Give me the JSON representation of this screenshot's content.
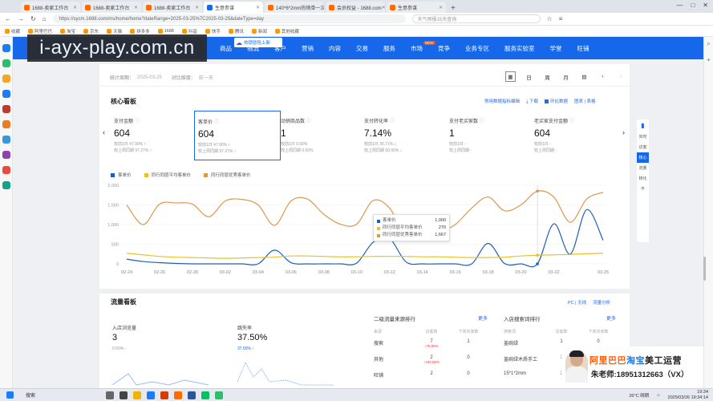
{
  "browser": {
    "tabs": [
      {
        "label": "1688-卖家工作台",
        "active": false
      },
      {
        "label": "1688-卖家工作台",
        "active": false
      },
      {
        "label": "1688-卖家工作台",
        "active": false
      },
      {
        "label": "生意参谋",
        "active": true
      },
      {
        "label": "140*6*2mm热销单一次性水",
        "active": false
      },
      {
        "label": "会员权益 - 1688.com",
        "active": false
      },
      {
        "label": "生意参谋",
        "active": false
      }
    ],
    "url": "https://sycm.1688.com/ms/home/home?dateRange=2025-03-25%7C2025-03-25&dateType=day",
    "search_placeholder": "天气预报15天查询",
    "bookmarks": [
      "收藏",
      "阿里巴巴",
      "淘宝",
      "京东",
      "天猫",
      "拼多多",
      "1688",
      "抖音",
      "快手",
      "腾讯",
      "新闻",
      "其他收藏"
    ],
    "window_controls": [
      "—",
      "□",
      "✕"
    ]
  },
  "watermark": "i-ayx-play.com.cn",
  "promo_badge": "热销冒险上新",
  "topnav": {
    "items": [
      "商品",
      "物流",
      "客户",
      "营销",
      "内容",
      "交易",
      "服务",
      "市场",
      "竞争",
      "业务专区",
      "服务实验室",
      "学堂",
      "旺铺"
    ],
    "new_badge": "NEW"
  },
  "statbar": {
    "period_label": "统计周期：",
    "period_value": "2025-03-25",
    "compare_label": "对比维度：",
    "compare_value": "前一天",
    "date_controls": [
      "日",
      "周",
      "月"
    ]
  },
  "core": {
    "title": "核心看板",
    "tools": [
      "常用数据指标编辑",
      "下载",
      "环比数据",
      "图表 | 表格"
    ],
    "metrics": [
      {
        "label": "支付金额",
        "value": "604",
        "sub1": "较前1日 47.90%",
        "sub2": "较上周同期 97.27%",
        "dir": "up",
        "selected": false
      },
      {
        "label": "客单价",
        "value": "604",
        "sub1": "较前1日 47.90%",
        "sub2": "较上周同期 97.27%",
        "dir": "up",
        "selected": true
      },
      {
        "label": "动销商品数",
        "value": "1",
        "sub1": "较前1日 0.00%",
        "sub2": "较上周同期 0.00%",
        "dir": "none",
        "selected": false
      },
      {
        "label": "支付转化率",
        "value": "7.14%",
        "sub1": "较前1日 35.71%",
        "sub2": "较上周同期 50.00%",
        "dir": "down",
        "selected": false
      },
      {
        "label": "支付老买家数",
        "value": "1",
        "sub1": "较前1日 -",
        "sub2": "较上周同期 -",
        "dir": "none",
        "selected": false
      },
      {
        "label": "老买家支付金额",
        "value": "604",
        "sub1": "较前1日 -",
        "sub2": "较上周同期 -",
        "dir": "none",
        "selected": false
      }
    ]
  },
  "chart_data": {
    "type": "line",
    "categories": [
      "02-24",
      "02-25",
      "02-26",
      "02-27",
      "02-28",
      "03-01",
      "03-02",
      "03-03",
      "03-04",
      "03-05",
      "03-06",
      "03-07",
      "03-08",
      "03-09",
      "03-10",
      "03-11",
      "03-12",
      "03-13",
      "03-14",
      "03-15",
      "03-16",
      "03-17",
      "03-18",
      "03-19",
      "03-20",
      "03-21",
      "03-22",
      "03-23",
      "03-24",
      "03-25"
    ],
    "tick_labels": [
      "02-24",
      "02-26",
      "02-28",
      "03-02",
      "03-04",
      "03-06",
      "03-08",
      "03-10",
      "03-12",
      "03-14",
      "03-16",
      "03-18",
      "03-20",
      "03-22",
      "03-25"
    ],
    "ylim": [
      0,
      2000
    ],
    "yticks": [
      "0",
      "500",
      "1,000",
      "1,500",
      "2,000"
    ],
    "series": [
      {
        "name": "客单价",
        "color": "#1d5fb8",
        "values": [
          120,
          60,
          30,
          10,
          0,
          0,
          0,
          0,
          0,
          350,
          30,
          0,
          0,
          0,
          20,
          550,
          640,
          50,
          0,
          0,
          0,
          0,
          520,
          10,
          0,
          0,
          1020,
          250,
          1380,
          600
        ]
      },
      {
        "name": "同行同层平均客单价",
        "color": "#e6c32a",
        "values": [
          270,
          230,
          190,
          170,
          160,
          150,
          140,
          150,
          160,
          170,
          200,
          200,
          190,
          180,
          180,
          190,
          190,
          190,
          180,
          180,
          170,
          160,
          160,
          170,
          200,
          220,
          230,
          240,
          260,
          270
        ]
      },
      {
        "name": "同行同层优秀客单价",
        "color": "#d9994a",
        "values": [
          1500,
          1000,
          1520,
          1550,
          1520,
          1200,
          1600,
          1640,
          1500,
          980,
          1600,
          1650,
          1260,
          1010,
          1010,
          1610,
          1420,
          720,
          820,
          820,
          1000,
          1420,
          1700,
          1350,
          1500,
          1850,
          1700,
          1060,
          1650,
          1820
        ]
      }
    ],
    "tooltip": {
      "rows": [
        {
          "name": "客单价",
          "value": "1,000"
        },
        {
          "name": "同行同层平均客单价",
          "value": "270"
        },
        {
          "name": "同行同层优秀客单价",
          "value": "1,667"
        }
      ]
    },
    "legend_position": "top-left",
    "grid": true
  },
  "flow": {
    "title": "流量看板",
    "tools": [
      "PC | 无线",
      "流量分析"
    ],
    "uv_label": "入店浏览量",
    "uv_value": "3",
    "uv_sub": "0.00% -",
    "conv_label": "跳失率",
    "conv_value": "37.50%",
    "conv_sub": "37.50% ↑",
    "rank1": {
      "title": "二级流量来源排行",
      "more": "更多",
      "cols": [
        "来源",
        "访客数",
        "下单买家数"
      ],
      "rows": [
        {
          "name": "搜索",
          "visitors": "7",
          "sub": "↑75.00%",
          "buyers": "1"
        },
        {
          "name": "其他",
          "visitors": "2",
          "sub": "↑100.00%",
          "buyers": "0"
        },
        {
          "name": "旺铺",
          "visitors": "2",
          "sub": "",
          "buyers": "0"
        }
      ]
    },
    "rank2": {
      "title": "入店搜索词排行",
      "more": "更多",
      "cols": [
        "搜索词",
        "访客数",
        "下单买家数"
      ],
      "rows": [
        {
          "name": "盖碗绿",
          "visitors": "1",
          "buyers": "0"
        },
        {
          "name": "盖碗绿木质手工",
          "visitors": "1",
          "buyers": "0"
        },
        {
          "name": "15*1*2mm",
          "visitors": "1",
          "buyers": "0"
        }
      ]
    }
  },
  "right_tools": [
    "实时",
    "访客",
    "核心",
    "流量",
    "转化",
    "不"
  ],
  "promo_overlay": {
    "brand_a": "阿里巴巴",
    "brand_b": "淘宝",
    "brand_c": "美工运营",
    "teacher": "朱老师:18951312663（VX）"
  },
  "taskbar": {
    "search": "搜索",
    "weather": "26°C 晴朗",
    "time": "19:34",
    "date": "2025/03/26 19:34:14"
  }
}
